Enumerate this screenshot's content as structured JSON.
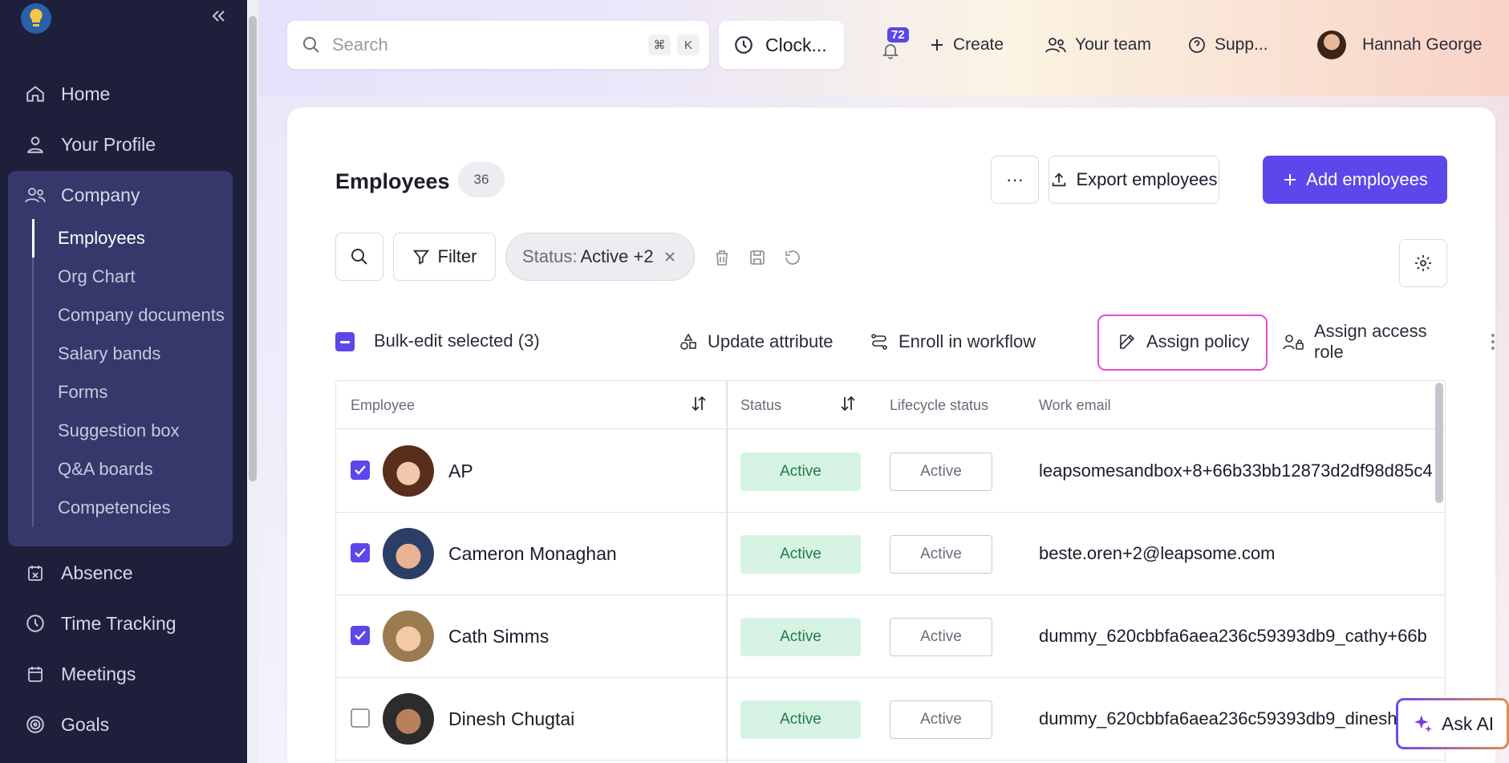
{
  "sidebar": {
    "nav": [
      {
        "label": "Home",
        "icon": "home-icon"
      },
      {
        "label": "Your Profile",
        "icon": "user-icon"
      },
      {
        "label": "Company",
        "icon": "people-icon"
      },
      {
        "label": "Absence",
        "icon": "calendar-x-icon"
      },
      {
        "label": "Time Tracking",
        "icon": "clock-icon"
      },
      {
        "label": "Meetings",
        "icon": "calendar-icon"
      },
      {
        "label": "Goals",
        "icon": "target-icon"
      }
    ],
    "company_sub": [
      "Employees",
      "Org Chart",
      "Company documents",
      "Salary bands",
      "Forms",
      "Suggestion box",
      "Q&A boards",
      "Competencies"
    ]
  },
  "topbar": {
    "search_placeholder": "Search",
    "shortcut_cmd": "⌘",
    "shortcut_key": "K",
    "clock_label": "Clock...",
    "notif_count": "72",
    "create_label": "Create",
    "team_label": "Your team",
    "support_label": "Supp...",
    "user_name": "Hannah George"
  },
  "page": {
    "title": "Employees",
    "count": "36",
    "more_label": "···",
    "export_label": "Export employees",
    "add_label": "Add employees",
    "filter_label": "Filter",
    "status_chip_key": "Status:",
    "status_chip_value": "Active +2"
  },
  "bulk": {
    "label": "Bulk-edit selected (3)",
    "update_attribute": "Update attribute",
    "enroll_workflow": "Enroll in workflow",
    "assign_policy": "Assign policy",
    "assign_access_role": "Assign access role"
  },
  "table": {
    "headers": {
      "employee": "Employee",
      "status": "Status",
      "lifecycle": "Lifecycle status",
      "email": "Work email"
    },
    "rows": [
      {
        "name": "AP",
        "status": "Active",
        "lifecycle": "Active",
        "email": "leapsomesandbox+8+66b33bb12873d2df98d85c4",
        "checked": true
      },
      {
        "name": "Cameron Monaghan",
        "status": "Active",
        "lifecycle": "Active",
        "email": "beste.oren+2@leapsome.com",
        "checked": true
      },
      {
        "name": "Cath Simms",
        "status": "Active",
        "lifecycle": "Active",
        "email": "dummy_620cbbfa6aea236c59393db9_cathy+66b",
        "checked": true
      },
      {
        "name": "Dinesh Chugtai",
        "status": "Active",
        "lifecycle": "Active",
        "email": "dummy_620cbbfa6aea236c59393db9_dinesh",
        "checked": false
      }
    ]
  },
  "ask_ai_label": "Ask AI",
  "colors": {
    "accent": "#5b47ea",
    "sidebar": "#1e1f3b",
    "active_green": "#d7f3e3",
    "highlight": "#e04fd9"
  }
}
